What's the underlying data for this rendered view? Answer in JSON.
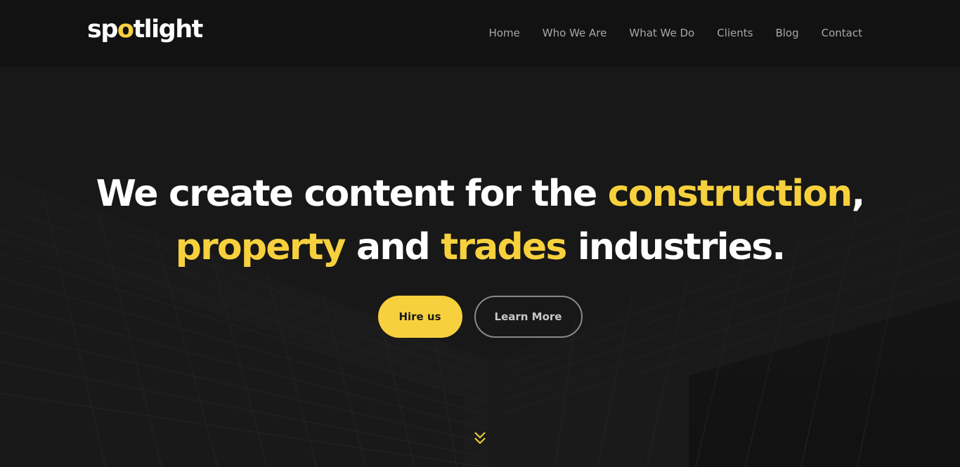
{
  "brand": {
    "logo_part1": "sp",
    "logo_highlight": "o",
    "logo_part2": "tlight",
    "accent_color": "#f7d13d"
  },
  "nav": {
    "items": [
      {
        "label": "Home"
      },
      {
        "label": "Who We Are"
      },
      {
        "label": "What We Do"
      },
      {
        "label": "Clients"
      },
      {
        "label": "Blog"
      },
      {
        "label": "Contact"
      }
    ]
  },
  "hero": {
    "line1_a": "We create content for the ",
    "line1_hl": "construction",
    "line1_b": ",",
    "line2_hl1": "property",
    "line2_a": " and ",
    "line2_hl2": "trades",
    "line2_b": " industries.",
    "primary_button": "Hire us",
    "secondary_button": "Learn More",
    "scroll_icon": "double-chevron-down-icon"
  }
}
